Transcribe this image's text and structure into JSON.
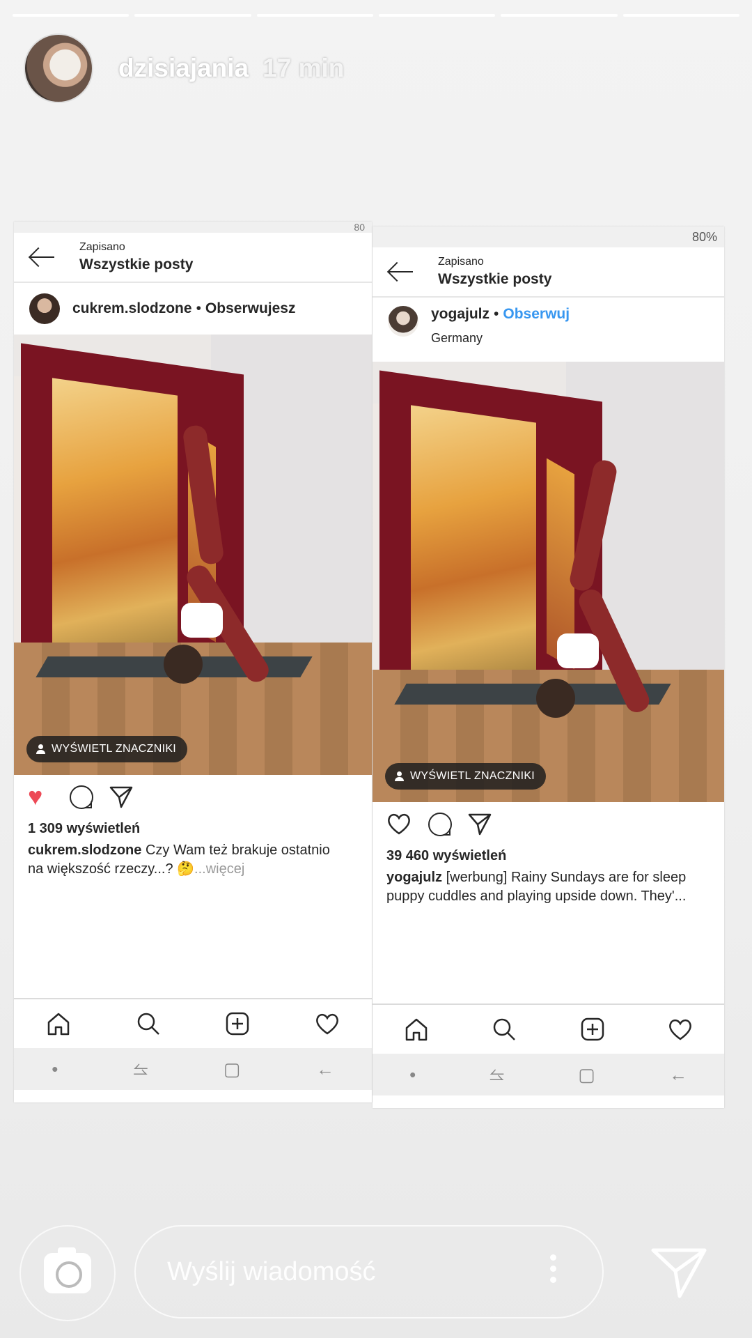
{
  "story": {
    "username": "dzisiajania",
    "time": "17 min",
    "progress_segments": 6,
    "progress_filled": 6
  },
  "left": {
    "status": "80",
    "topbar": {
      "small": "Zapisano",
      "title": "Wszystkie posty"
    },
    "post": {
      "username": "cukrem.slodzone",
      "dot": "•",
      "follow": "Obserwujesz"
    },
    "tag_button": "WYŚWIETL ZNACZNIKI",
    "liked": true,
    "views": "1 309 wyświetleń",
    "caption_user": "cukrem.slodzone",
    "caption_line1": " Czy Wam też brakuje ostatnio",
    "caption_line2": "na większość rzeczy...? 🤔",
    "caption_more": "...więcej"
  },
  "right": {
    "status": "80%",
    "topbar": {
      "small": "Zapisano",
      "title": "Wszystkie posty"
    },
    "post": {
      "username": "yogajulz",
      "dot": "•",
      "follow": "Obserwuj",
      "location": "Germany"
    },
    "tag_button": "WYŚWIETL ZNACZNIKI",
    "liked": false,
    "views": "39 460 wyświetleń",
    "caption_user": "yogajulz",
    "caption_line1": " [werbung] Rainy Sundays are for sleep",
    "caption_line2": "puppy cuddles and playing upside down. They'..."
  },
  "reply": {
    "placeholder": "Wyślij wiadomość"
  },
  "colors": {
    "like_red": "#ed4956",
    "follow_blue": "#3897f0",
    "frame_red": "#7a1422"
  },
  "icons": [
    "camera-icon",
    "more-dots-icon",
    "send-icon",
    "home-icon",
    "search-icon",
    "add-icon",
    "heart-icon",
    "comment-icon",
    "back-arrow-icon"
  ]
}
